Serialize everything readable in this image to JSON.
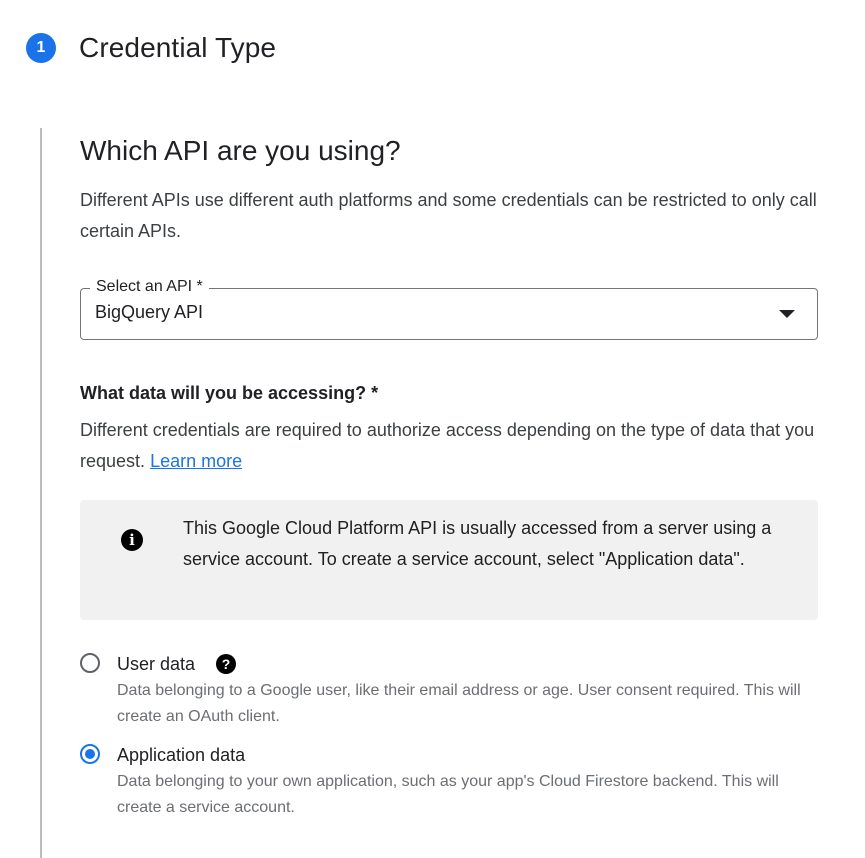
{
  "step": {
    "number": "1",
    "title": "Credential Type"
  },
  "api_section": {
    "title": "Which API are you using?",
    "description": "Different APIs use different auth platforms and some credentials can be restricted to only call certain APIs."
  },
  "select_api": {
    "label": "Select an API *",
    "value": "BigQuery API"
  },
  "data_section": {
    "question": "What data will you be accessing? *",
    "description": "Different credentials are required to authorize access depending on the type of data that you request.",
    "learn_more": "Learn more"
  },
  "info_box": {
    "icon_glyph": "i",
    "text": "This Google Cloud Platform API is usually accessed from a server using a service account. To create a service account, select \"Application data\"."
  },
  "options": [
    {
      "label": "User data",
      "description": "Data belonging to a Google user, like their email address or age. User consent required. This will create an OAuth client.",
      "selected": false,
      "help_glyph": "?"
    },
    {
      "label": "Application data",
      "description": "Data belonging to your own application, such as your app's Cloud Firestore backend. This will create a service account.",
      "selected": true
    }
  ],
  "colors": {
    "accent": "#1a73e8",
    "info_background": "#f1f1f1",
    "secondary_text": "#6b6e72"
  },
  "icons": {
    "step_badge": "step-number-badge",
    "info": "info-icon",
    "help": "help-icon",
    "dropdown": "dropdown-arrow-icon"
  }
}
